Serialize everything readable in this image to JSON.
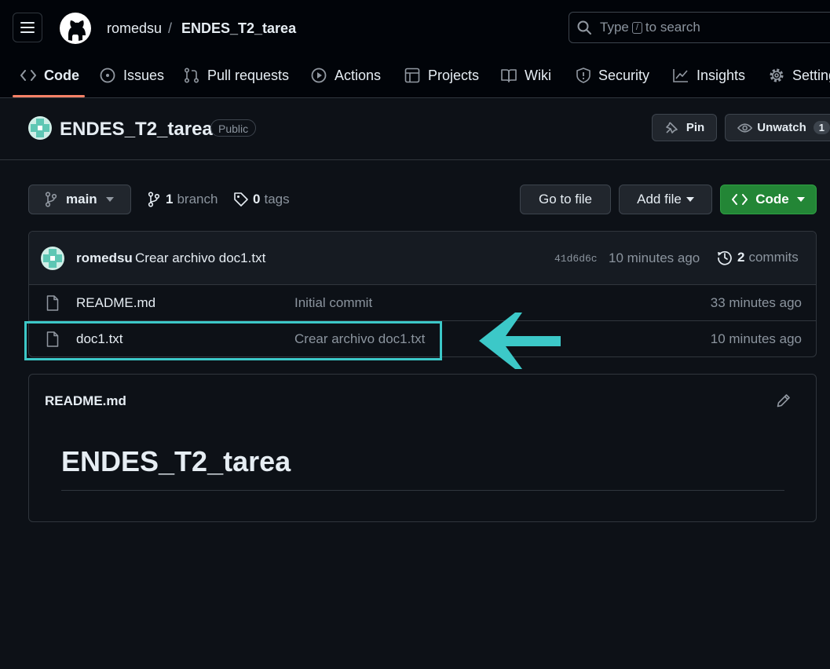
{
  "header": {
    "owner": "romedsu",
    "separator": "/",
    "repo": "ENDES_T2_tarea",
    "search": {
      "prefix": "Type",
      "key": "/",
      "suffix": "to search"
    }
  },
  "nav": {
    "code": "Code",
    "issues": "Issues",
    "pulls": "Pull requests",
    "actions": "Actions",
    "projects": "Projects",
    "wiki": "Wiki",
    "security": "Security",
    "insights": "Insights",
    "settings": "Settings"
  },
  "repo": {
    "title": "ENDES_T2_tarea",
    "visibility": "Public",
    "pin_label": "Pin",
    "unwatch_label": "Unwatch",
    "watch_count": "1"
  },
  "toolbar": {
    "branch_name": "main",
    "branch_count": "1",
    "branch_word": "branch",
    "tag_count": "0",
    "tag_word": "tags",
    "go_to_file": "Go to file",
    "add_file": "Add file",
    "code": "Code"
  },
  "latest_commit": {
    "author": "romedsu",
    "message": "Crear archivo doc1.txt",
    "sha": "41d6d6c",
    "time": "10 minutes ago",
    "commit_count": "2",
    "commit_word": "commits"
  },
  "files": [
    {
      "name": "README.md",
      "message": "Initial commit",
      "time": "33 minutes ago",
      "icon": "file-icon"
    },
    {
      "name": "doc1.txt",
      "message": "Crear archivo doc1.txt",
      "time": "10 minutes ago",
      "icon": "file-icon"
    }
  ],
  "readme": {
    "filename": "README.md",
    "heading": "ENDES_T2_tarea"
  },
  "annotation": {
    "highlight_color": "#3cc8c8"
  }
}
